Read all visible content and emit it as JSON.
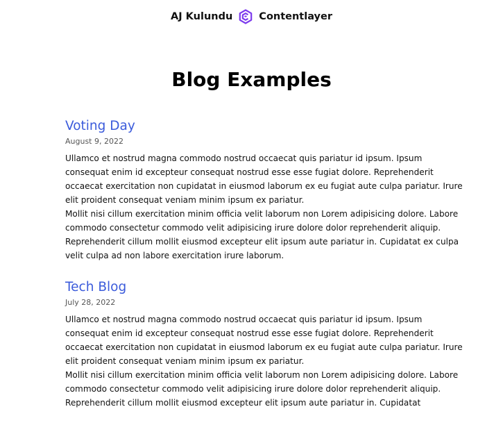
{
  "header": {
    "author": "AJ Kulundu",
    "logo_icon": "contentlayer-logo-icon",
    "brand": "Contentlayer",
    "accent_color": "#7c3aed"
  },
  "page": {
    "title": "Blog Examples"
  },
  "posts": [
    {
      "title": "Voting Day",
      "date": "August 9, 2022",
      "paragraphs": [
        "Ullamco et nostrud magna commodo nostrud occaecat quis pariatur id ipsum. Ipsum consequat enim id excepteur consequat nostrud esse esse fugiat dolore. Reprehenderit occaecat exercitation non cupidatat in eiusmod laborum ex eu fugiat aute culpa pariatur. Irure elit proident consequat veniam minim ipsum ex pariatur.",
        "Mollit nisi cillum exercitation minim officia velit laborum non Lorem adipisicing dolore. Labore commodo consectetur commodo velit adipisicing irure dolore dolor reprehenderit aliquip. Reprehenderit cillum mollit eiusmod excepteur elit ipsum aute pariatur in. Cupidatat ex culpa velit culpa ad non labore exercitation irure laborum."
      ]
    },
    {
      "title": "Tech Blog",
      "date": "July 28, 2022",
      "paragraphs": [
        "Ullamco et nostrud magna commodo nostrud occaecat quis pariatur id ipsum. Ipsum consequat enim id excepteur consequat nostrud esse esse fugiat dolore. Reprehenderit occaecat exercitation non cupidatat in eiusmod laborum ex eu fugiat aute culpa pariatur. Irure elit proident consequat veniam minim ipsum ex pariatur.",
        "Mollit nisi cillum exercitation minim officia velit laborum non Lorem adipisicing dolore. Labore commodo consectetur commodo velit adipisicing irure dolore dolor reprehenderit aliquip. Reprehenderit cillum mollit eiusmod excepteur elit ipsum aute pariatur in. Cupidatat"
      ]
    }
  ]
}
